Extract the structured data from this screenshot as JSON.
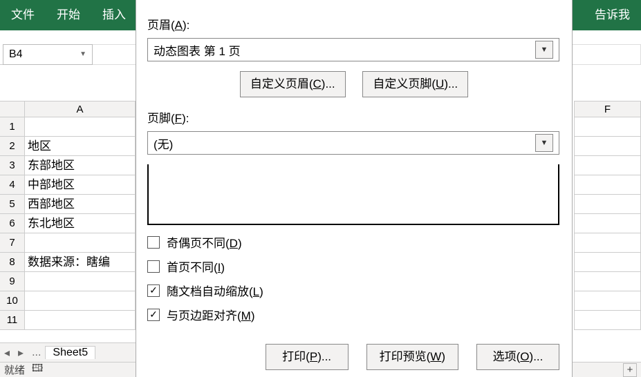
{
  "ribbon": {
    "file": "文件",
    "home": "开始",
    "insert": "插入",
    "tellme": "告诉我"
  },
  "namebox": {
    "value": "B4"
  },
  "sheet": {
    "colA": "A",
    "colF": "F",
    "rows": [
      {
        "n": "1",
        "a": ""
      },
      {
        "n": "2",
        "a": "地区"
      },
      {
        "n": "3",
        "a": "东部地区"
      },
      {
        "n": "4",
        "a": "中部地区"
      },
      {
        "n": "5",
        "a": "西部地区"
      },
      {
        "n": "6",
        "a": "东北地区"
      },
      {
        "n": "7",
        "a": ""
      },
      {
        "n": "8",
        "a": "数据来源：瞎编"
      },
      {
        "n": "9",
        "a": ""
      },
      {
        "n": "10",
        "a": ""
      },
      {
        "n": "11",
        "a": ""
      }
    ],
    "tabnav1": "◂",
    "tabnav2": "▸",
    "tabnav3": "...",
    "tabname": "Sheet5"
  },
  "statusbar": {
    "ready": "就绪",
    "icon": "🖽",
    "plus": "+"
  },
  "dialog": {
    "header_label": "页眉(A):",
    "header_value": "动态图表 第 1 页",
    "custom_header_btn": "自定义页眉(C)...",
    "custom_footer_btn": "自定义页脚(U)...",
    "footer_label": "页脚(F):",
    "footer_value": "(无)",
    "chk_odd_even": "奇偶页不同(D)",
    "chk_first_diff": "首页不同(I)",
    "chk_scale": "随文档自动缩放(L)",
    "chk_align": "与页边距对齐(M)",
    "btn_print": "打印(P)...",
    "btn_preview": "打印预览(W)",
    "btn_options": "选项(O)..."
  }
}
